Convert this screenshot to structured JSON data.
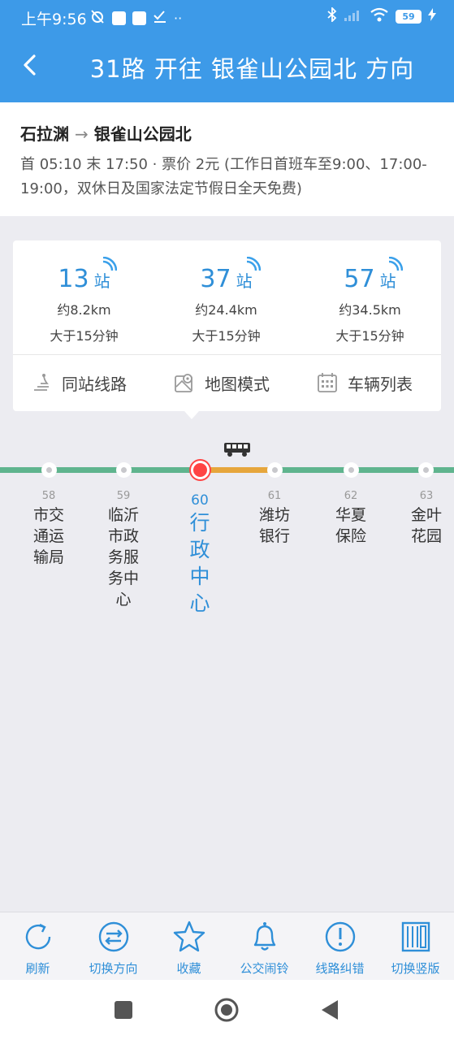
{
  "status_bar": {
    "time": "上午9:56",
    "battery": "59"
  },
  "header": {
    "title": "31路 开往 银雀山公园北 方向",
    "back_icon": "chevron-left-icon"
  },
  "route": {
    "from": "石拉渊",
    "arrow": "→",
    "to": "银雀山公园北",
    "description": "首 05:10 末 17:50 · 票价 2元 (工作日首班车至9:00、17:00-19:00，双休日及国家法定节假日全天免费)"
  },
  "stats": [
    {
      "count": "13",
      "unit": "站",
      "distance": "约8.2km",
      "time": "大于15分钟"
    },
    {
      "count": "37",
      "unit": "站",
      "distance": "约24.4km",
      "time": "大于15分钟"
    },
    {
      "count": "57",
      "unit": "站",
      "distance": "约34.5km",
      "time": "大于15分钟"
    }
  ],
  "actions": [
    {
      "label": "同站线路",
      "icon": "transfer-route-icon"
    },
    {
      "label": "地图模式",
      "icon": "map-icon"
    },
    {
      "label": "车辆列表",
      "icon": "calendar-grid-icon"
    }
  ],
  "stops": [
    {
      "num": "58",
      "name": "市交通运输局",
      "current": false
    },
    {
      "num": "59",
      "name": "临沂市政务服务中心",
      "current": false
    },
    {
      "num": "60",
      "name": "行政中心",
      "current": true
    },
    {
      "num": "61",
      "name": "潍坊银行",
      "current": false
    },
    {
      "num": "62",
      "name": "华夏保险",
      "current": false
    },
    {
      "num": "63",
      "name": "金叶花园",
      "current": false
    }
  ],
  "toolbar": [
    {
      "label": "刷新",
      "icon": "refresh-icon"
    },
    {
      "label": "切换方向",
      "icon": "swap-direction-icon"
    },
    {
      "label": "收藏",
      "icon": "star-icon"
    },
    {
      "label": "公交闹铃",
      "icon": "bell-icon"
    },
    {
      "label": "线路纠错",
      "icon": "alert-icon"
    },
    {
      "label": "切换竖版",
      "icon": "layout-vertical-icon"
    }
  ],
  "colors": {
    "primary": "#3d9ae8",
    "accent_text": "#2f8fd8",
    "line_green": "#5fb48e",
    "line_orange": "#e6a63c",
    "current_stop": "#ff4444"
  }
}
